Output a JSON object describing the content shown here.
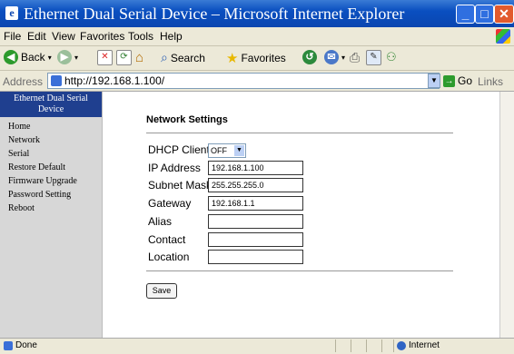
{
  "window": {
    "title": "Ethernet Dual Serial Device – Microsoft Internet Explorer"
  },
  "menubar": {
    "items": [
      "File",
      "Edit",
      "View",
      "Favorites",
      "Tools",
      "Help"
    ]
  },
  "toolbar": {
    "back": "Back",
    "search": "Search",
    "favorites": "Favorites"
  },
  "addressbar": {
    "label": "Address",
    "url": "http://192.168.1.100/",
    "go": "Go",
    "links": "Links"
  },
  "sidebar": {
    "header": "Ethernet Dual Serial Device",
    "items": [
      "Home",
      "Network",
      "Serial",
      "Restore Default",
      "Firmware Upgrade",
      "Password Setting",
      "Reboot"
    ]
  },
  "form": {
    "heading": "Network Settings",
    "dhcp_label": "DHCP Client",
    "dhcp_value": "OFF",
    "ip_label": "IP Address",
    "ip_value": "192.168.1.100",
    "mask_label": "Subnet Mask",
    "mask_value": "255.255.255.0",
    "gateway_label": "Gateway",
    "gateway_value": "192.168.1.1",
    "alias_label": "Alias",
    "alias_value": "",
    "contact_label": "Contact",
    "contact_value": "",
    "location_label": "Location",
    "location_value": "",
    "save_label": "Save"
  },
  "status": {
    "left": "Done",
    "zone": "Internet"
  },
  "colors": {
    "title_bar": "#0b46b0",
    "sidebar_header": "#1f3f8f",
    "sidebar_bg": "#d7d7d7"
  }
}
